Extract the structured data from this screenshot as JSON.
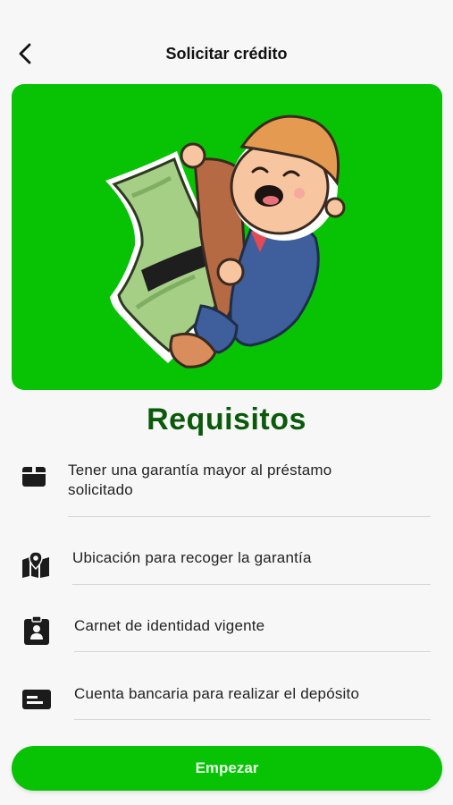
{
  "header": {
    "title": "Solicitar crédito",
    "back_icon": "chevron-left-icon"
  },
  "hero": {
    "bg_color": "#07c304",
    "illustration": "cartoon-man-with-money-bill"
  },
  "section": {
    "heading": "Requisitos",
    "heading_color": "#0b5a0b"
  },
  "requirements": [
    {
      "icon": "box-icon",
      "text_line1": "Tener una garantía mayor al préstamo",
      "text_line2": "solicitado"
    },
    {
      "icon": "map-pin-icon",
      "text_line1": "Ubicación para recoger la garantía"
    },
    {
      "icon": "id-badge-icon",
      "text_line1": "Carnet de identidad vigente"
    },
    {
      "icon": "bank-card-icon",
      "text_line1": "Cuenta bancaria para realizar el depósito"
    }
  ],
  "actions": {
    "start_label": "Empezar",
    "accent_color": "#07c304"
  }
}
